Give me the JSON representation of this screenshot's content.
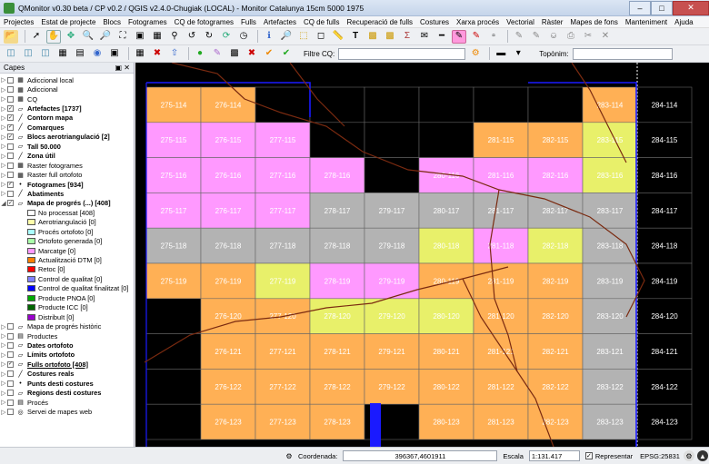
{
  "window": {
    "title": "QMonitor v0.30 beta / CP v0.2 / QGIS v2.4.0-Chugiak (LOCAL) - Monitor Catalunya 15cm 5000 1975"
  },
  "menu": [
    "Projectes",
    "Estat de projecte",
    "Blocs",
    "Fotogrames",
    "CQ de fotogrames",
    "Fulls",
    "Artefactes",
    "CQ de fulls",
    "Recuperació de fulls",
    "Costures",
    "Xarxa procés",
    "Vectorial",
    "Ràster",
    "Mapes de fons",
    "Manteniment",
    "Ajuda"
  ],
  "toolbar2": {
    "filter_label": "Filtre CQ:",
    "filter_value": "",
    "toponym_label": "Topònim:",
    "toponym_value": ""
  },
  "layers_panel": {
    "title": "Capes",
    "items": [
      {
        "label": "Adiccional local",
        "checked": false,
        "bold": false,
        "icon": "raster-icon"
      },
      {
        "label": "Adiccional",
        "checked": false,
        "bold": false,
        "icon": "raster-icon"
      },
      {
        "label": "CQ",
        "checked": false,
        "bold": false,
        "icon": "raster-icon"
      },
      {
        "label": "Artefactes [1737]",
        "checked": true,
        "bold": true,
        "icon": "polygon-icon"
      },
      {
        "label": "Contorn mapa",
        "checked": true,
        "bold": true,
        "icon": "line-icon"
      },
      {
        "label": "Comarques",
        "checked": true,
        "bold": true,
        "icon": "line-icon"
      },
      {
        "label": "Blocs aerotriangulació [2]",
        "checked": true,
        "bold": true,
        "icon": "polygon-icon"
      },
      {
        "label": "Tall 50.000",
        "checked": false,
        "bold": true,
        "icon": "polygon-icon"
      },
      {
        "label": "Zona útil",
        "checked": false,
        "bold": true,
        "icon": "line-icon"
      },
      {
        "label": "Raster fotogrames",
        "checked": false,
        "bold": false,
        "icon": "raster-icon"
      },
      {
        "label": "Raster full ortofoto",
        "checked": false,
        "bold": false,
        "icon": "raster-icon"
      },
      {
        "label": "Fotogrames [934]",
        "checked": true,
        "bold": true,
        "icon": "point-icon"
      },
      {
        "label": "Abatiments",
        "checked": false,
        "bold": true,
        "icon": "line-icon"
      },
      {
        "label": "Mapa de progrés (...) [408]",
        "checked": true,
        "bold": true,
        "icon": "polygon-icon"
      },
      {
        "label": "No processat [408]",
        "legend_color": "#ffffff"
      },
      {
        "label": "Aerotriangulació [0]",
        "legend_color": "#ffffaa"
      },
      {
        "label": "Procés ortofoto [0]",
        "legend_color": "#aaffff"
      },
      {
        "label": "Ortofoto generada [0]",
        "legend_color": "#aaffaa"
      },
      {
        "label": "Marcatge [0]",
        "legend_color": "#ff99ff"
      },
      {
        "label": "Actualització DTM [0]",
        "legend_color": "#ff7f00"
      },
      {
        "label": "Retoc [0]",
        "legend_color": "#ff0000"
      },
      {
        "label": "Control de qualitat [0]",
        "legend_color": "#8080ff"
      },
      {
        "label": "Control de qualitat finalitzat [0]",
        "legend_color": "#0000ff"
      },
      {
        "label": "Producte PNOA [0]",
        "legend_color": "#00aa00"
      },
      {
        "label": "Producte ICC [0]",
        "legend_color": "#006600"
      },
      {
        "label": "Distribuït [0]",
        "legend_color": "#9900cc"
      },
      {
        "label": "Mapa de progrés històric",
        "checked": false,
        "bold": false,
        "icon": "polygon-icon"
      },
      {
        "label": "Productes",
        "checked": false,
        "bold": false,
        "icon": "folder-icon"
      },
      {
        "label": "Dates ortofoto",
        "checked": false,
        "bold": true,
        "icon": "polygon-icon"
      },
      {
        "label": "Límits ortofoto",
        "checked": false,
        "bold": true,
        "icon": "polygon-icon"
      },
      {
        "label": "Fulls ortofoto [408]",
        "checked": true,
        "bold": true,
        "icon": "polygon-icon",
        "selected": true
      },
      {
        "label": "Costures reals",
        "checked": false,
        "bold": true,
        "icon": "line-icon"
      },
      {
        "label": "Punts desti costures",
        "checked": false,
        "bold": true,
        "icon": "point-icon"
      },
      {
        "label": "Regions desti costures",
        "checked": false,
        "bold": true,
        "icon": "polygon-icon"
      },
      {
        "label": "Procés",
        "checked": false,
        "bold": false,
        "icon": "folder-icon"
      },
      {
        "label": "Servei de mapes web",
        "checked": false,
        "bold": false,
        "icon": "globe-icon"
      }
    ]
  },
  "map": {
    "colors": {
      "orange": "#ffb055",
      "pink": "#ff99ff",
      "gray": "#b3b3b3",
      "yellow": "#e8f06a",
      "black": "#000000",
      "blue_border": "#1a1aff",
      "boundary": "#7a2a10"
    },
    "columns": [
      "275",
      "276",
      "277",
      "278",
      "279",
      "280",
      "281",
      "282",
      "283",
      "284"
    ],
    "rows": [
      "114",
      "115",
      "116",
      "117",
      "118",
      "119",
      "120",
      "121",
      "122",
      "123"
    ],
    "cells": [
      [
        "orange",
        "orange",
        "black",
        "black",
        "black",
        "black",
        "black",
        "black",
        "orange",
        "black"
      ],
      [
        "pink",
        "pink",
        "pink",
        "black",
        "black",
        "black",
        "orange",
        "orange",
        "yellow",
        "black"
      ],
      [
        "pink",
        "pink",
        "pink",
        "pink",
        "black",
        "pink",
        "pink",
        "pink",
        "yellow",
        "black"
      ],
      [
        "pink",
        "pink",
        "pink",
        "gray",
        "gray",
        "gray",
        "gray",
        "gray",
        "gray",
        "black"
      ],
      [
        "gray",
        "gray",
        "gray",
        "gray",
        "gray",
        "yellow",
        "pink",
        "yellow",
        "gray",
        "black"
      ],
      [
        "orange",
        "orange",
        "yellow",
        "pink",
        "pink",
        "orange",
        "orange",
        "orange",
        "gray",
        "black"
      ],
      [
        "black",
        "orange",
        "orange",
        "yellow",
        "yellow",
        "yellow",
        "orange",
        "orange",
        "gray",
        "black"
      ],
      [
        "black",
        "orange",
        "orange",
        "orange",
        "orange",
        "orange",
        "orange",
        "orange",
        "gray",
        "black"
      ],
      [
        "black",
        "orange",
        "orange",
        "orange",
        "orange",
        "orange",
        "orange",
        "orange",
        "gray",
        "black"
      ],
      [
        "black",
        "orange",
        "orange",
        "orange",
        "black",
        "orange",
        "orange",
        "orange",
        "gray",
        "black"
      ]
    ]
  },
  "status": {
    "coord_label": "Coordenada:",
    "coord_value": "396367,4601911",
    "scale_label": "Escala",
    "scale_value": "1:131.417",
    "render_label": "Representar",
    "render_checked": true,
    "epsg": "EPSG:25831"
  }
}
